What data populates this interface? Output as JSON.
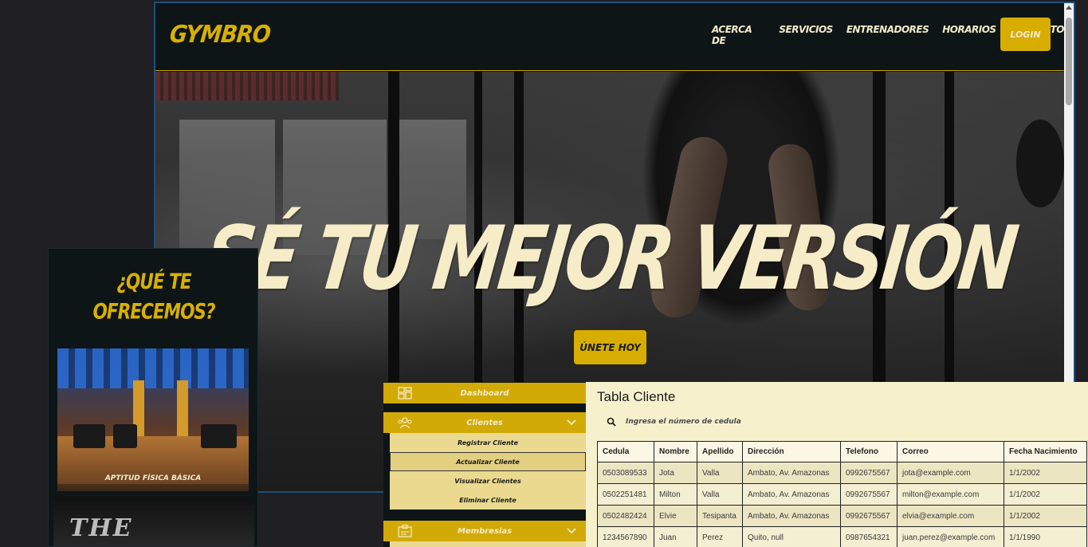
{
  "site": {
    "logo": "GYMBRO",
    "nav": [
      "ACERCA DE",
      "SERVICIOS",
      "ENTRENADORES",
      "HORARIOS",
      "CONTACTO"
    ],
    "login_label": "LOGIN",
    "hero_title": "SÉ TU MEJOR VERSIÓN",
    "join_label": "ÚNETE HOY",
    "accent_color": "#d6ad00",
    "cream_color": "#f6ecc7"
  },
  "offer": {
    "title_line1": "¿QUÉ TE",
    "title_line2": "OFRECEMOS?",
    "card_label": "APTITUD FÍSICA BÁSICA",
    "card2_text": "THE"
  },
  "sidebar": {
    "dashboard_label": "Dashboard",
    "clientes_label": "Clientes",
    "clientes_items": [
      "Registrar Cliente",
      "Actualizar Cliente",
      "Visualizar Clientes",
      "Eliminar Cliente"
    ],
    "active_item": "Actualizar Cliente",
    "membresias_label": "Membresias"
  },
  "table": {
    "title": "Tabla Cliente",
    "search_placeholder": "Ingresa el número de cedula",
    "columns": [
      "Cedula",
      "Nombre",
      "Apellido",
      "Dirección",
      "Telefono",
      "Correo",
      "Fecha Nacimiento"
    ],
    "rows": [
      [
        "0503089533",
        "Jota",
        "Valla",
        "Ambato, Av. Amazonas",
        "0992675567",
        "jota@example.com",
        "1/1/2002"
      ],
      [
        "0502251481",
        "Milton",
        "Valla",
        "Ambato, Av. Amazonas",
        "0992675567",
        "milton@example.com",
        "1/1/2002"
      ],
      [
        "0502482424",
        "Elvie",
        "Tesipanta",
        "Ambato, Av. Amazonas",
        "0992675567",
        "elvia@example.com",
        "1/1/2002"
      ],
      [
        "1234567890",
        "Juan",
        "Perez",
        "Quito, null",
        "0987654321",
        "juan.perez@example.com",
        "1/1/1990"
      ]
    ]
  }
}
